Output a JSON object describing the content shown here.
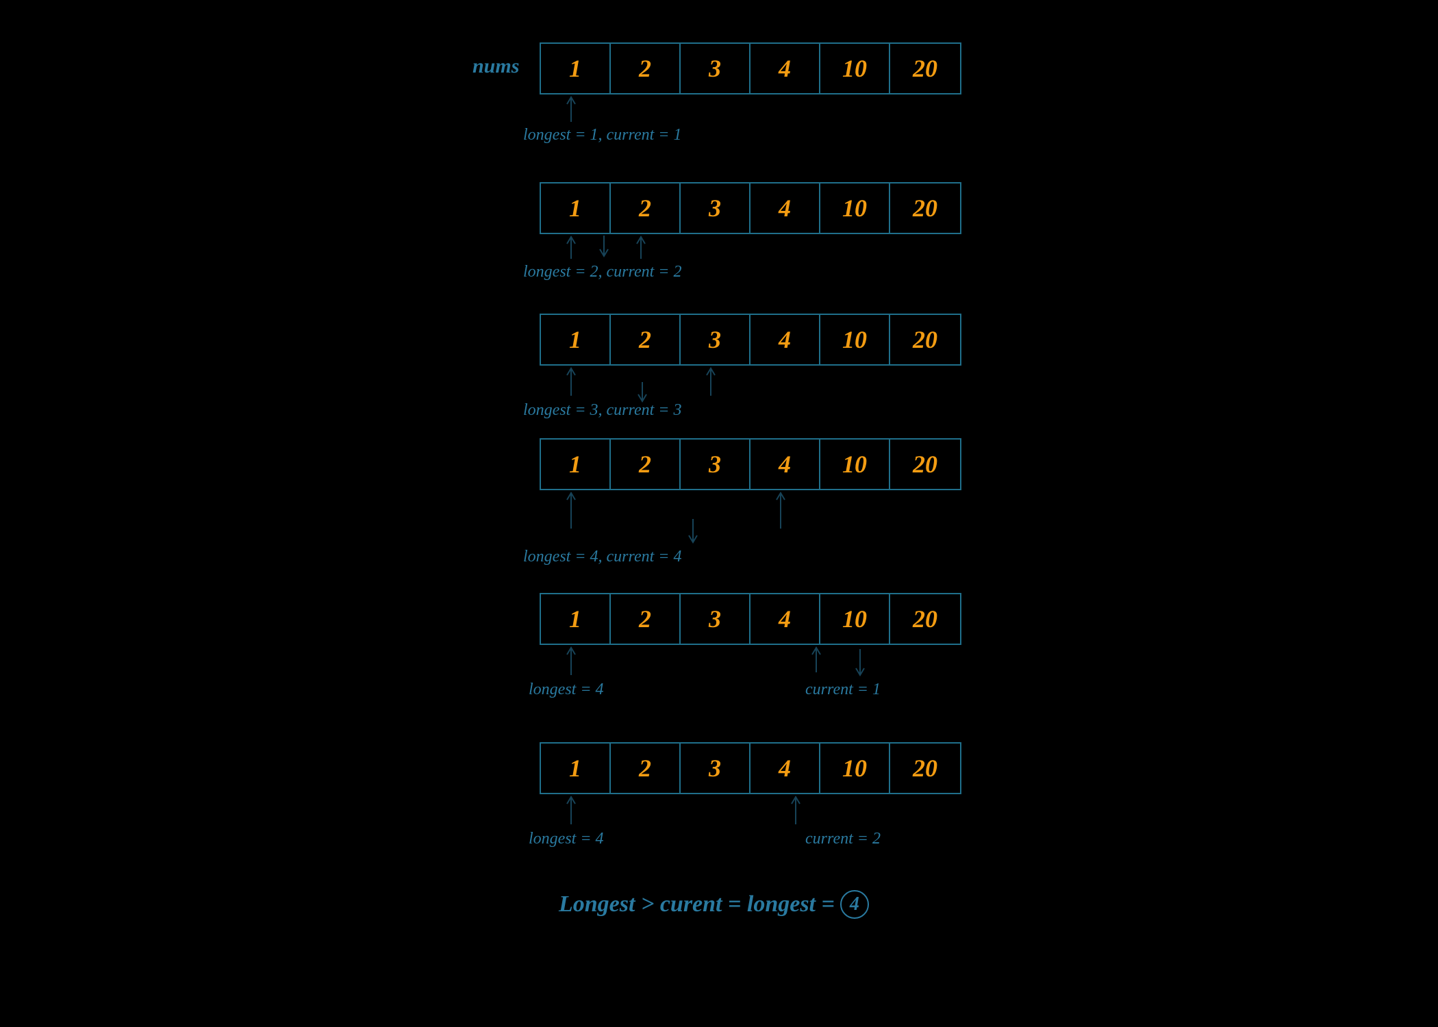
{
  "label_nums": "nums",
  "array_values": [
    "1",
    "2",
    "3",
    "4",
    "10",
    "20"
  ],
  "steps": [
    {
      "caption_left": "longest = 1, current = 1",
      "caption_right": ""
    },
    {
      "caption_left": "longest = 2, current = 2",
      "caption_right": ""
    },
    {
      "caption_left": "longest = 3, current = 3",
      "caption_right": ""
    },
    {
      "caption_left": "longest = 4, current = 4",
      "caption_right": ""
    },
    {
      "caption_left": "longest = 4",
      "caption_right": "current = 1"
    },
    {
      "caption_left": "longest = 4",
      "caption_right": "current = 2"
    }
  ],
  "conclusion_prefix": "Longest > curent = longest =",
  "conclusion_value": "4",
  "colors": {
    "teal": "#1f6f8b",
    "orange": "#f39c12"
  }
}
